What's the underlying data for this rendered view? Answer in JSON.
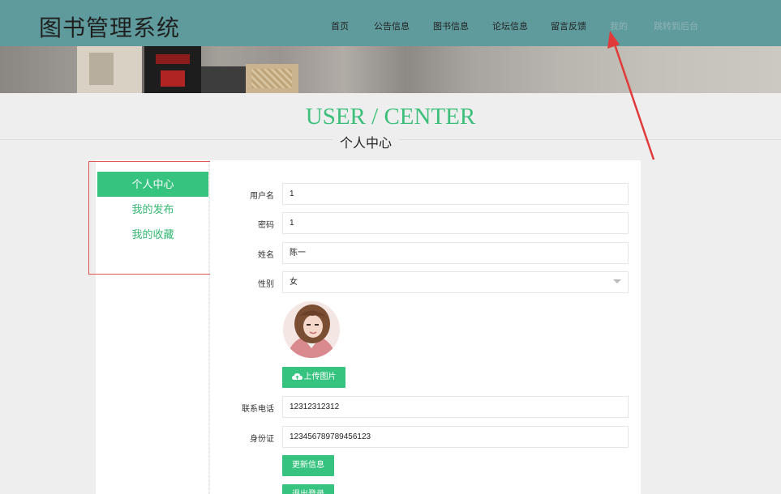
{
  "header": {
    "brand": "图书管理系统",
    "nav": [
      {
        "label": "首页"
      },
      {
        "label": "公告信息"
      },
      {
        "label": "图书信息"
      },
      {
        "label": "论坛信息"
      },
      {
        "label": "留言反馈"
      },
      {
        "label": "我的"
      },
      {
        "label": "跳转到后台"
      }
    ]
  },
  "page": {
    "title_en": "USER / CENTER",
    "title_cn": "个人中心"
  },
  "sidebar": {
    "items": [
      {
        "label": "个人中心",
        "active": true
      },
      {
        "label": "我的发布"
      },
      {
        "label": "我的收藏"
      }
    ]
  },
  "form": {
    "username": {
      "label": "用户名",
      "value": "1"
    },
    "password": {
      "label": "密码",
      "value": "1"
    },
    "name": {
      "label": "姓名",
      "value": "陈一"
    },
    "gender": {
      "label": "性别",
      "value": "女"
    },
    "upload_label": "上传图片",
    "phone": {
      "label": "联系电话",
      "value": "12312312312"
    },
    "idcard": {
      "label": "身份证",
      "value": "123456789789456123"
    },
    "update_label": "更新信息",
    "logout_label": "退出登录"
  },
  "colors": {
    "header_bg": "#5f9b9d",
    "accent": "#36c27f",
    "annotation": "#e45151"
  }
}
